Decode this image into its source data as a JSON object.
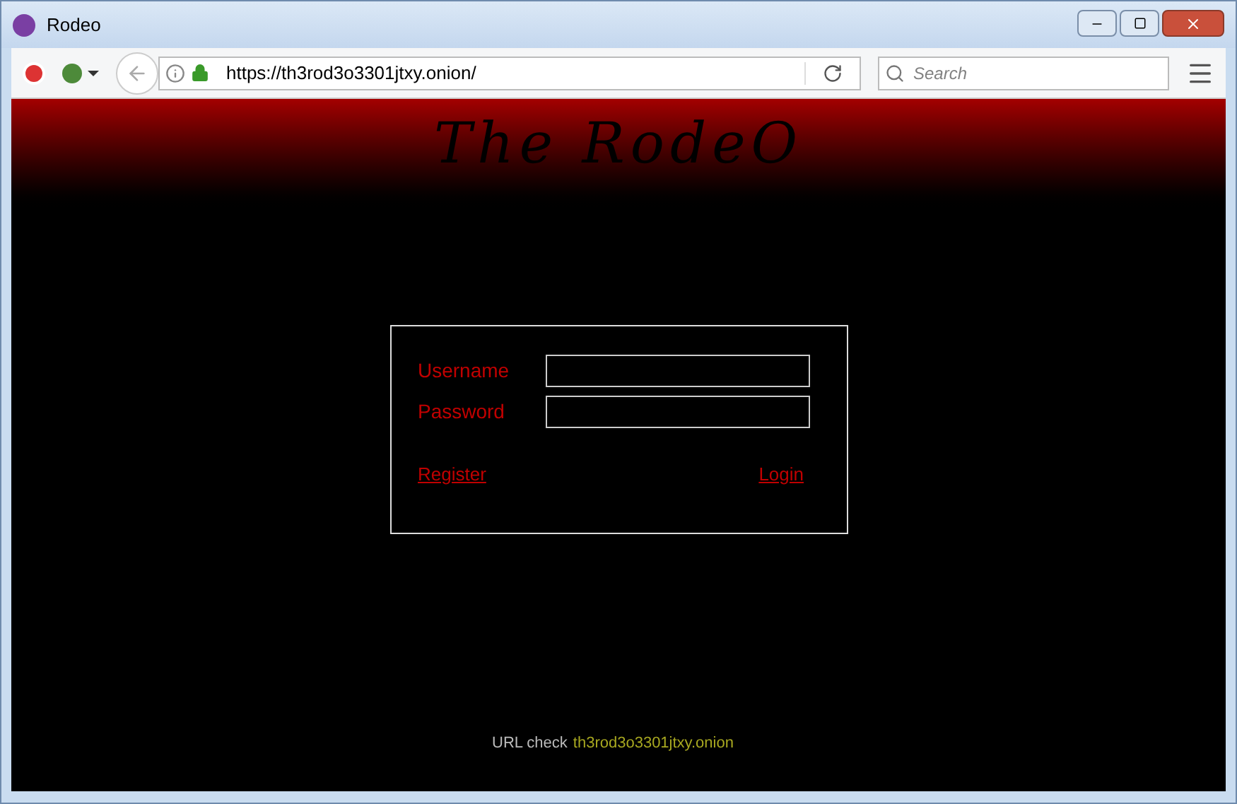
{
  "window": {
    "title": "Rodeo"
  },
  "toolbar": {
    "url": "https://th3rod3o3301jtxy.onion/",
    "search": {
      "placeholder": "Search"
    }
  },
  "banner": {
    "title": "The RodeO"
  },
  "login": {
    "fields": [
      {
        "label": "Username"
      },
      {
        "label": "Password"
      }
    ],
    "links": [
      {
        "label": "Register"
      },
      {
        "label": "Login"
      }
    ]
  },
  "footer": {
    "label": "URL check",
    "url": "th3rod3o3301jtxy.onion"
  }
}
